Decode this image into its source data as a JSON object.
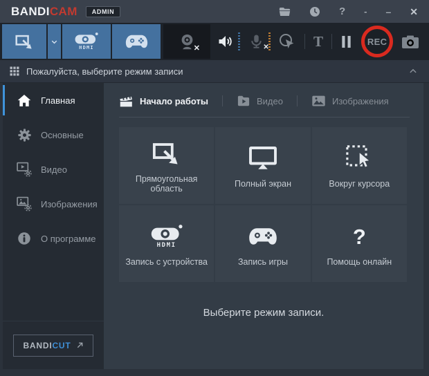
{
  "titlebar": {
    "logo_part1": "BANDI",
    "logo_part2": "CAM",
    "badge": "ADMIN",
    "help_glyph": "?",
    "tray_glyph": "-",
    "minimize_glyph": "–",
    "close_glyph": "✕"
  },
  "toolbar": {
    "hdmi_label": "HDMI",
    "text_tool_glyph": "T",
    "rec_label": "REC",
    "webcam_off_glyph": "✕",
    "mic_off_glyph": "✕"
  },
  "prompt_bar": {
    "text": "Пожалуйста, выберите режим записи"
  },
  "sidebar": {
    "items": [
      {
        "label": "Главная"
      },
      {
        "label": "Основные"
      },
      {
        "label": "Видео"
      },
      {
        "label": "Изображения"
      },
      {
        "label": "О программе"
      }
    ],
    "footer": {
      "brand_part1": "BANDI",
      "brand_part2": "CUT"
    }
  },
  "main": {
    "tabs": [
      {
        "label": "Начало работы"
      },
      {
        "label": "Видео"
      },
      {
        "label": "Изображения"
      }
    ],
    "tiles": [
      {
        "label": "Прямоугольная область"
      },
      {
        "label": "Полный экран"
      },
      {
        "label": "Вокруг курсора"
      },
      {
        "label": "Запись с устройства",
        "icon_text": "HDMI"
      },
      {
        "label": "Запись игры"
      },
      {
        "label": "Помощь онлайн",
        "icon_text": "?"
      }
    ],
    "message": "Выберите режим записи."
  },
  "colors": {
    "accent_blue": "#44719f",
    "active_indicator_blue": "#3f93da",
    "rec_ring_red": "#d92a1f",
    "logo_red": "#c23a30",
    "meter_blue": "#3f6f9e",
    "meter_orange": "#bd7c33"
  }
}
